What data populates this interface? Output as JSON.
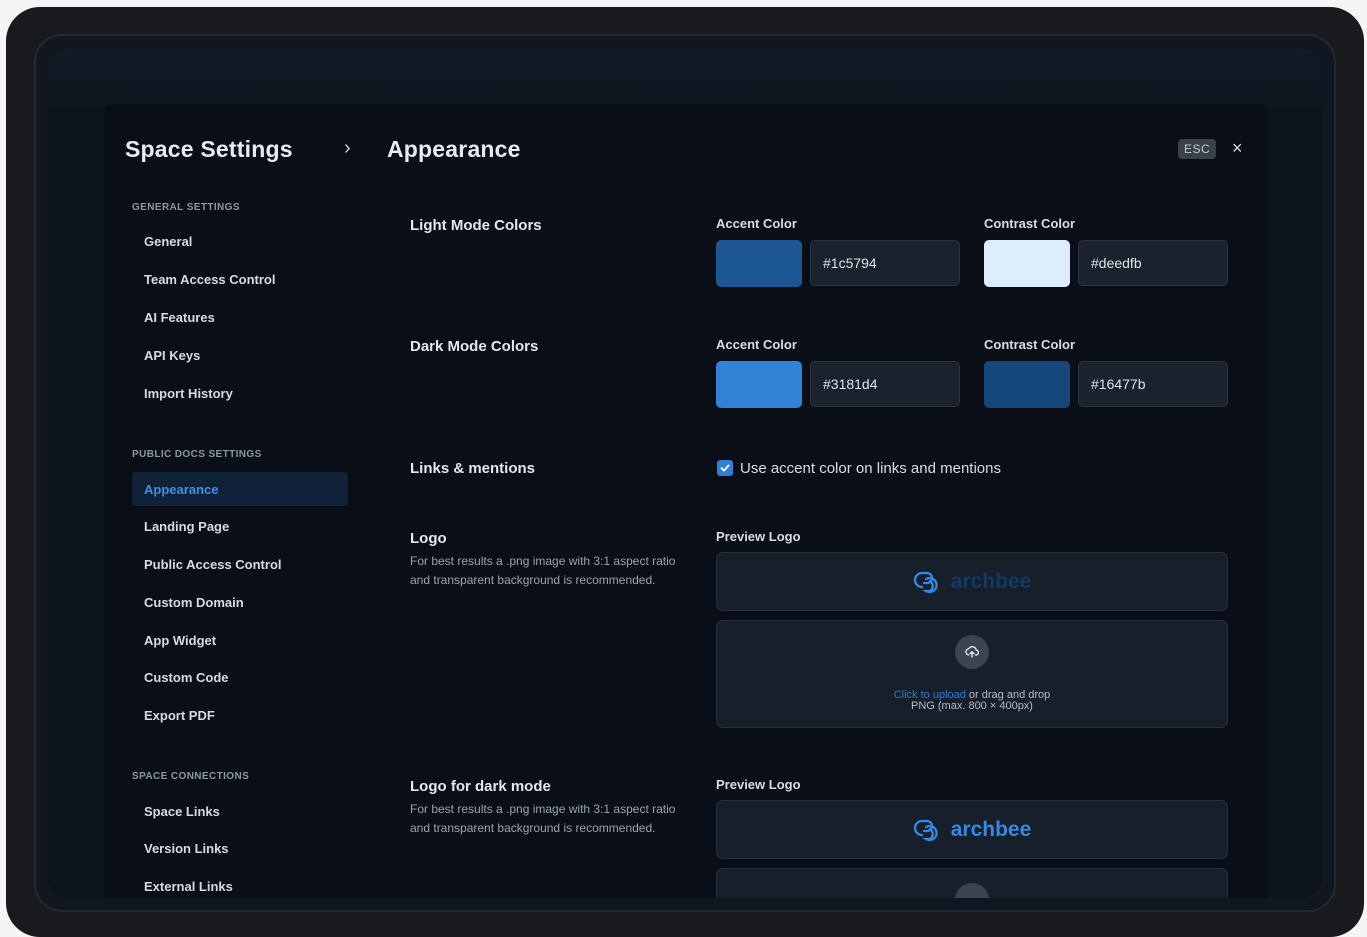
{
  "header": {
    "title": "Space Settings",
    "breadcrumb_sep": "›",
    "page_title": "Appearance",
    "esc_label": "ESC",
    "close_glyph": "×"
  },
  "sidebar": {
    "general": {
      "heading": "GENERAL SETTINGS",
      "items": [
        "General",
        "Team Access Control",
        "AI Features",
        "API Keys",
        "Import History"
      ]
    },
    "public": {
      "heading": "PUBLIC DOCS SETTINGS",
      "items": [
        "Appearance",
        "Landing Page",
        "Public Access Control",
        "Custom Domain",
        "App Widget",
        "Custom Code",
        "Export PDF"
      ]
    },
    "connections": {
      "heading": "SPACE CONNECTIONS",
      "items": [
        "Space Links",
        "Version Links",
        "External Links"
      ]
    },
    "active_item": "Appearance"
  },
  "light_mode": {
    "label": "Light Mode Colors",
    "accent_label": "Accent Color",
    "accent_value": "#1c5794",
    "contrast_label": "Contrast Color",
    "contrast_value": "#deedfb"
  },
  "dark_mode": {
    "label": "Dark Mode Colors",
    "accent_label": "Accent Color",
    "accent_value": "#3181d4",
    "contrast_label": "Contrast Color",
    "contrast_value": "#16477b"
  },
  "links": {
    "label": "Links & mentions",
    "checkbox_label": "Use accent color on links and mentions",
    "checked": true
  },
  "logo": {
    "label": "Logo",
    "description": "For best results a .png image with 3:1 aspect ratio and transparent background is recommended.",
    "preview_label": "Preview Logo",
    "preview_word": "archbee",
    "upload_link": "Click to upload",
    "upload_rest": " or drag and drop",
    "upload_hint": "PNG (max. 800 × 400px)"
  },
  "logo_dark": {
    "label": "Logo for dark mode",
    "description": "For best results a .png image with 3:1 aspect ratio and transparent background is recommended.",
    "preview_label": "Preview Logo",
    "preview_word": "archbee"
  }
}
